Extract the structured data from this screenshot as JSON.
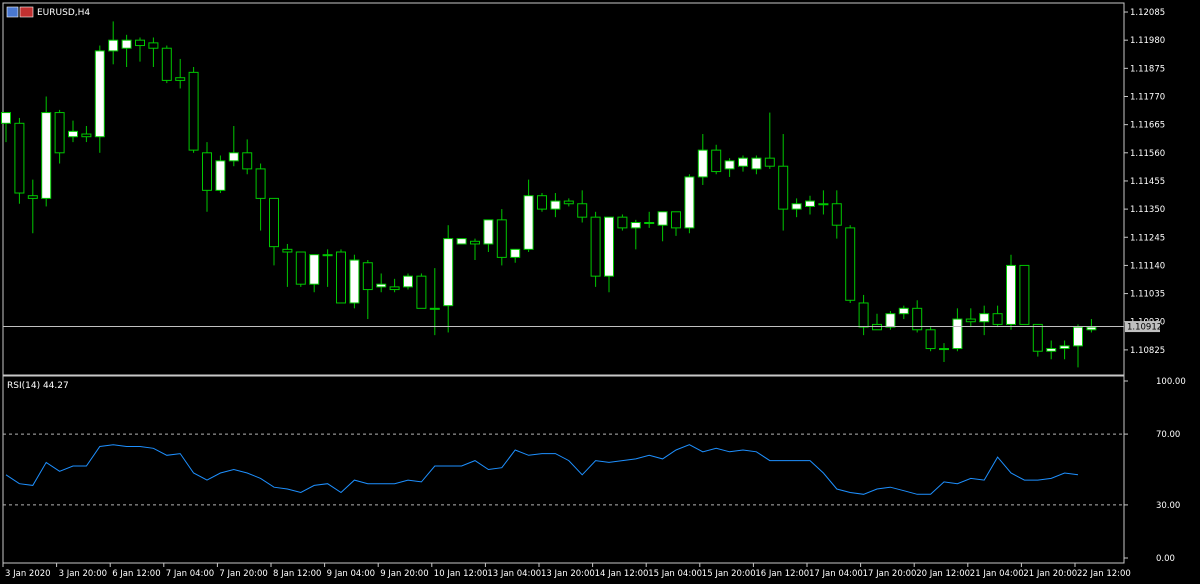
{
  "window": {
    "symbol_title": "EURUSD,H4"
  },
  "colors": {
    "background": "#000000",
    "frame": "#c8c8c8",
    "bull_body": "#ffffff",
    "bear_body": "#000000",
    "wick": "#00c800",
    "rsi_line": "#1e90ff",
    "level_line": "#b4b4b4",
    "price_line": "#c0c0c0",
    "price_tag_bg": "#c0c0c0"
  },
  "chart_data": [
    {
      "type": "candlestick",
      "title": "EURUSD,H4",
      "ylim": [
        1.1075,
        1.121
      ],
      "y_ticks": [
        "1.12085",
        "1.11980",
        "1.11875",
        "1.11770",
        "1.11665",
        "1.11560",
        "1.11455",
        "1.11350",
        "1.11245",
        "1.11140",
        "1.11035",
        "1.10930",
        "1.10825"
      ],
      "last_price": "1.10912",
      "last_price_value": 1.10912,
      "x_tick_labels": [
        "3 Jan 2020",
        "3 Jan 20:00",
        "6 Jan 12:00",
        "7 Jan 04:00",
        "7 Jan 20:00",
        "8 Jan 12:00",
        "9 Jan 04:00",
        "9 Jan 20:00",
        "10 Jan 12:00",
        "13 Jan 04:00",
        "13 Jan 20:00",
        "14 Jan 12:00",
        "15 Jan 04:00",
        "15 Jan 20:00",
        "16 Jan 12:00",
        "17 Jan 04:00",
        "17 Jan 20:00",
        "20 Jan 12:00",
        "21 Jan 04:00",
        "21 Jan 20:00",
        "22 Jan 12:00"
      ],
      "x_tick_positions": [
        0,
        4,
        8,
        12,
        16,
        20,
        24,
        28,
        32,
        36,
        40,
        44,
        48,
        52,
        56,
        60,
        64,
        68,
        72,
        76,
        80
      ],
      "candles": [
        {
          "o": 1.1167,
          "h": 1.1171,
          "l": 1.116,
          "c": 1.1171
        },
        {
          "o": 1.1167,
          "h": 1.1169,
          "l": 1.1137,
          "c": 1.1141
        },
        {
          "o": 1.114,
          "h": 1.1146,
          "l": 1.1126,
          "c": 1.1139
        },
        {
          "o": 1.1139,
          "h": 1.1177,
          "l": 1.1136,
          "c": 1.1171
        },
        {
          "o": 1.1171,
          "h": 1.1172,
          "l": 1.1152,
          "c": 1.1156
        },
        {
          "o": 1.1162,
          "h": 1.1168,
          "l": 1.116,
          "c": 1.1164
        },
        {
          "o": 1.1163,
          "h": 1.1166,
          "l": 1.116,
          "c": 1.1162
        },
        {
          "o": 1.1162,
          "h": 1.1196,
          "l": 1.1156,
          "c": 1.1194
        },
        {
          "o": 1.1194,
          "h": 1.1205,
          "l": 1.1189,
          "c": 1.1198
        },
        {
          "o": 1.1195,
          "h": 1.12,
          "l": 1.1188,
          "c": 1.1198
        },
        {
          "o": 1.1198,
          "h": 1.1199,
          "l": 1.119,
          "c": 1.1196
        },
        {
          "o": 1.1197,
          "h": 1.1199,
          "l": 1.1188,
          "c": 1.1195
        },
        {
          "o": 1.1195,
          "h": 1.1196,
          "l": 1.1182,
          "c": 1.1183
        },
        {
          "o": 1.1184,
          "h": 1.1191,
          "l": 1.118,
          "c": 1.1183
        },
        {
          "o": 1.1186,
          "h": 1.1188,
          "l": 1.1156,
          "c": 1.1157
        },
        {
          "o": 1.1156,
          "h": 1.116,
          "l": 1.1134,
          "c": 1.1142
        },
        {
          "o": 1.1142,
          "h": 1.1155,
          "l": 1.1141,
          "c": 1.1153
        },
        {
          "o": 1.1153,
          "h": 1.1166,
          "l": 1.1151,
          "c": 1.1156
        },
        {
          "o": 1.1156,
          "h": 1.1161,
          "l": 1.1148,
          "c": 1.115
        },
        {
          "o": 1.115,
          "h": 1.1152,
          "l": 1.1127,
          "c": 1.1139
        },
        {
          "o": 1.1139,
          "h": 1.1139,
          "l": 1.1114,
          "c": 1.1121
        },
        {
          "o": 1.112,
          "h": 1.1122,
          "l": 1.1106,
          "c": 1.1119
        },
        {
          "o": 1.1119,
          "h": 1.1119,
          "l": 1.1106,
          "c": 1.1107
        },
        {
          "o": 1.1107,
          "h": 1.1118,
          "l": 1.1104,
          "c": 1.1118
        },
        {
          "o": 1.1118,
          "h": 1.112,
          "l": 1.1106,
          "c": 1.1118
        },
        {
          "o": 1.1119,
          "h": 1.112,
          "l": 1.1102,
          "c": 1.11
        },
        {
          "o": 1.11,
          "h": 1.1118,
          "l": 1.1098,
          "c": 1.1116
        },
        {
          "o": 1.1115,
          "h": 1.1116,
          "l": 1.1094,
          "c": 1.1105
        },
        {
          "o": 1.1106,
          "h": 1.1111,
          "l": 1.1104,
          "c": 1.1107
        },
        {
          "o": 1.1106,
          "h": 1.1109,
          "l": 1.1104,
          "c": 1.1105
        },
        {
          "o": 1.1106,
          "h": 1.1111,
          "l": 1.1105,
          "c": 1.111
        },
        {
          "o": 1.111,
          "h": 1.1111,
          "l": 1.1098,
          "c": 1.1098
        },
        {
          "o": 1.1098,
          "h": 1.1113,
          "l": 1.1088,
          "c": 1.1098
        },
        {
          "o": 1.1099,
          "h": 1.1129,
          "l": 1.1089,
          "c": 1.1124
        },
        {
          "o": 1.1122,
          "h": 1.1124,
          "l": 1.1122,
          "c": 1.1124
        },
        {
          "o": 1.1123,
          "h": 1.1124,
          "l": 1.1116,
          "c": 1.1122
        },
        {
          "o": 1.1122,
          "h": 1.1131,
          "l": 1.1119,
          "c": 1.1131
        },
        {
          "o": 1.1131,
          "h": 1.1135,
          "l": 1.1114,
          "c": 1.1117
        },
        {
          "o": 1.1117,
          "h": 1.112,
          "l": 1.1115,
          "c": 1.112
        },
        {
          "o": 1.112,
          "h": 1.1146,
          "l": 1.1119,
          "c": 1.114
        },
        {
          "o": 1.114,
          "h": 1.1141,
          "l": 1.1134,
          "c": 1.1135
        },
        {
          "o": 1.1135,
          "h": 1.1141,
          "l": 1.1132,
          "c": 1.1138
        },
        {
          "o": 1.1138,
          "h": 1.1139,
          "l": 1.1136,
          "c": 1.1137
        },
        {
          "o": 1.1137,
          "h": 1.1142,
          "l": 1.113,
          "c": 1.1132
        },
        {
          "o": 1.1132,
          "h": 1.1134,
          "l": 1.1106,
          "c": 1.111
        },
        {
          "o": 1.111,
          "h": 1.1132,
          "l": 1.1104,
          "c": 1.1132
        },
        {
          "o": 1.1132,
          "h": 1.1133,
          "l": 1.1127,
          "c": 1.1128
        },
        {
          "o": 1.1128,
          "h": 1.1131,
          "l": 1.112,
          "c": 1.113
        },
        {
          "o": 1.113,
          "h": 1.1134,
          "l": 1.1128,
          "c": 1.113
        },
        {
          "o": 1.1129,
          "h": 1.1134,
          "l": 1.1123,
          "c": 1.1134
        },
        {
          "o": 1.1134,
          "h": 1.1134,
          "l": 1.1125,
          "c": 1.1128
        },
        {
          "o": 1.1128,
          "h": 1.1148,
          "l": 1.1126,
          "c": 1.1147
        },
        {
          "o": 1.1147,
          "h": 1.1163,
          "l": 1.1144,
          "c": 1.1157
        },
        {
          "o": 1.1157,
          "h": 1.1159,
          "l": 1.1148,
          "c": 1.1149
        },
        {
          "o": 1.115,
          "h": 1.1154,
          "l": 1.1147,
          "c": 1.1153
        },
        {
          "o": 1.1151,
          "h": 1.1155,
          "l": 1.1149,
          "c": 1.1154
        },
        {
          "o": 1.115,
          "h": 1.1155,
          "l": 1.1148,
          "c": 1.1154
        },
        {
          "o": 1.1154,
          "h": 1.1171,
          "l": 1.115,
          "c": 1.1151
        },
        {
          "o": 1.1151,
          "h": 1.1163,
          "l": 1.1127,
          "c": 1.1135
        },
        {
          "o": 1.1135,
          "h": 1.1139,
          "l": 1.1132,
          "c": 1.1137
        },
        {
          "o": 1.1136,
          "h": 1.114,
          "l": 1.1133,
          "c": 1.1138
        },
        {
          "o": 1.1137,
          "h": 1.1142,
          "l": 1.1133,
          "c": 1.1137
        },
        {
          "o": 1.1137,
          "h": 1.1142,
          "l": 1.1124,
          "c": 1.1129
        },
        {
          "o": 1.1128,
          "h": 1.1129,
          "l": 1.11,
          "c": 1.1101
        },
        {
          "o": 1.11,
          "h": 1.1103,
          "l": 1.1088,
          "c": 1.1091
        },
        {
          "o": 1.1092,
          "h": 1.1096,
          "l": 1.109,
          "c": 1.109
        },
        {
          "o": 1.1091,
          "h": 1.1097,
          "l": 1.109,
          "c": 1.1096
        },
        {
          "o": 1.1096,
          "h": 1.1099,
          "l": 1.1094,
          "c": 1.1098
        },
        {
          "o": 1.1098,
          "h": 1.1101,
          "l": 1.1089,
          "c": 1.109
        },
        {
          "o": 1.109,
          "h": 1.1091,
          "l": 1.1082,
          "c": 1.1083
        },
        {
          "o": 1.1083,
          "h": 1.1085,
          "l": 1.1078,
          "c": 1.1083
        },
        {
          "o": 1.1083,
          "h": 1.1098,
          "l": 1.1082,
          "c": 1.1094
        },
        {
          "o": 1.1094,
          "h": 1.1098,
          "l": 1.1091,
          "c": 1.1093
        },
        {
          "o": 1.1093,
          "h": 1.1099,
          "l": 1.1088,
          "c": 1.1096
        },
        {
          "o": 1.1096,
          "h": 1.1099,
          "l": 1.1091,
          "c": 1.1092
        },
        {
          "o": 1.1092,
          "h": 1.1118,
          "l": 1.109,
          "c": 1.1114
        },
        {
          "o": 1.1114,
          "h": 1.1114,
          "l": 1.1093,
          "c": 1.1092
        },
        {
          "o": 1.1092,
          "h": 1.1092,
          "l": 1.108,
          "c": 1.1082
        },
        {
          "o": 1.1082,
          "h": 1.1086,
          "l": 1.1079,
          "c": 1.1083
        },
        {
          "o": 1.1083,
          "h": 1.1086,
          "l": 1.1079,
          "c": 1.1084
        },
        {
          "o": 1.1084,
          "h": 1.1092,
          "l": 1.1076,
          "c": 1.1091
        },
        {
          "o": 1.109,
          "h": 1.1094,
          "l": 1.1089,
          "c": 1.1091
        }
      ]
    },
    {
      "type": "line",
      "title": "RSI(14) 44.27",
      "ylim": [
        0,
        100
      ],
      "y_ticks": [
        "100.00",
        "70.00",
        "30.00",
        "0.00"
      ],
      "levels": [
        70,
        30
      ],
      "values": [
        47,
        42,
        41,
        54,
        49,
        52,
        52,
        63,
        64,
        63,
        63,
        62,
        58,
        59,
        48,
        44,
        48,
        50,
        48,
        45,
        40,
        39,
        37,
        41,
        42,
        37,
        44,
        42,
        42,
        42,
        44,
        43,
        52,
        52,
        52,
        55,
        50,
        51,
        61,
        58,
        59,
        59,
        55,
        47,
        55,
        54,
        55,
        56,
        58,
        56,
        61,
        64,
        60,
        62,
        60,
        61,
        60,
        55,
        55,
        55,
        55,
        48,
        39,
        37,
        36,
        39,
        40,
        38,
        36,
        36,
        43,
        42,
        45,
        44,
        57,
        48,
        44,
        44,
        45,
        48,
        47
      ]
    }
  ]
}
